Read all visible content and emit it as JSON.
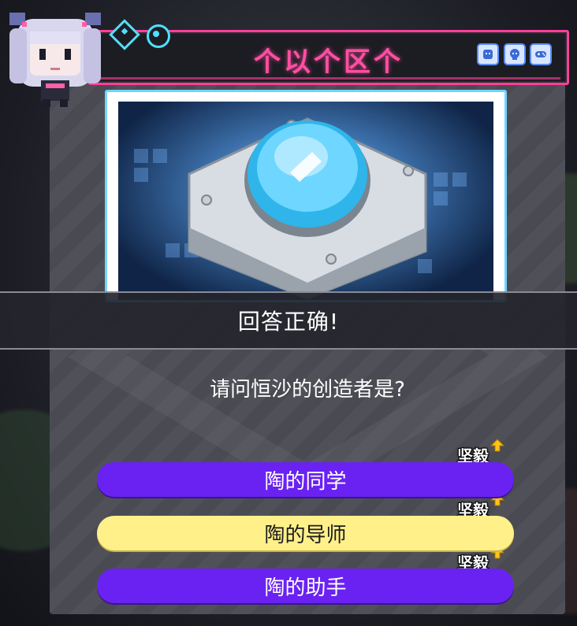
{
  "header": {
    "title": "个以个区个"
  },
  "result": {
    "text": "回答正确!"
  },
  "quiz": {
    "question": "请问恒沙的创造者是?",
    "answers": [
      {
        "label": "陶的同学",
        "tag": "坚毅",
        "state": "normal"
      },
      {
        "label": "陶的导师",
        "tag": "坚毅",
        "state": "correct"
      },
      {
        "label": "陶的助手",
        "tag": "坚毅",
        "state": "normal"
      }
    ]
  },
  "colors": {
    "accent_pink": "#ff3f9a",
    "accent_cyan": "#4fe0ff",
    "answer_purple": "#6a22f2",
    "answer_correct": "#fff08a",
    "tag_arrow": "#ffc21a"
  },
  "icons": {
    "corner_buttons": [
      "ghost-icon",
      "skull-icon",
      "gamepad-icon"
    ]
  }
}
